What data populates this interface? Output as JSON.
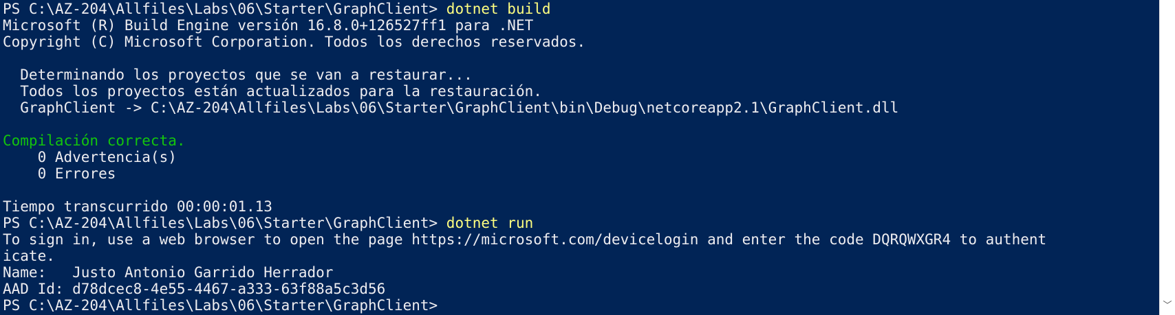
{
  "terminal": {
    "background": "#012456",
    "foreground": "#EEEDF0",
    "command_color": "#FFFF80",
    "success_color": "#13C40D",
    "prompt": "PS C:\\AZ-204\\Allfiles\\Labs\\06\\Starter\\GraphClient> ",
    "cmd_build": "dotnet build",
    "build_l1": "Microsoft (R) Build Engine versión 16.8.0+126527ff1 para .NET",
    "build_l2": "Copyright (C) Microsoft Corporation. Todos los derechos reservados.",
    "build_l3": "  Determinando los proyectos que se van a restaurar...",
    "build_l4": "  Todos los proyectos están actualizados para la restauración.",
    "build_l5": "  GraphClient -> C:\\AZ-204\\Allfiles\\Labs\\06\\Starter\\GraphClient\\bin\\Debug\\netcoreapp2.1\\GraphClient.dll",
    "build_success": "Compilación correcta.",
    "warnings": "    0 Advertencia(s)",
    "errors": "    0 Errores",
    "elapsed": "Tiempo transcurrido 00:00:01.13",
    "cmd_run": "dotnet run",
    "run_l1": "To sign in, use a web browser to open the page https://microsoft.com/devicelogin and enter the code DQRQWXGR4 to authent",
    "run_l2": "icate.",
    "name_line": "Name:   Justo Antonio Garrido Herrador",
    "aad_line": "AAD Id: d78dcec8-4e55-4467-a333-63f88a5c3d56"
  },
  "scrollbar": {
    "down_arrow": "﹀"
  }
}
